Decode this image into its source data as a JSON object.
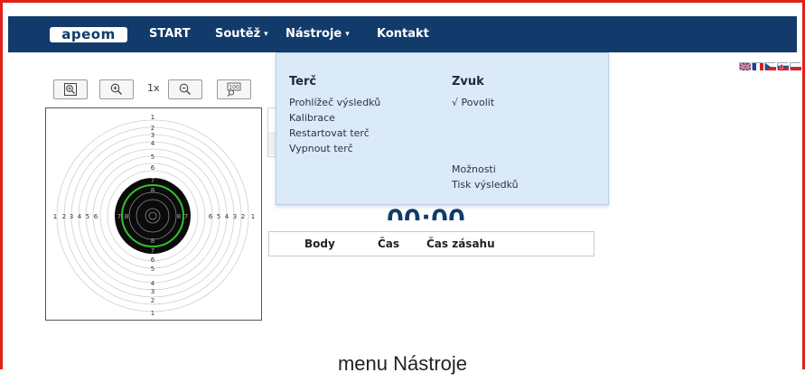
{
  "navbar": {
    "logo_text": "apeom",
    "items": [
      {
        "label": "START",
        "has_caret": false
      },
      {
        "label": "Soutěž",
        "has_caret": true,
        "caret": "▾"
      },
      {
        "label": "Nástroje",
        "has_caret": true,
        "caret": "▾",
        "active": true
      },
      {
        "label": "Kontakt",
        "has_caret": false
      }
    ],
    "background": "#123b6b"
  },
  "languages": [
    "English",
    "Français",
    "Čeština",
    "Slovenčina",
    "Polski"
  ],
  "toolbar": {
    "zoom_fit_icon": "zoom-fit-icon",
    "zoom_in_icon": "zoom-in-icon",
    "zoom_level": "1x",
    "zoom_out_icon": "zoom-out-icon",
    "zoom_100_icon": "zoom-100-icon",
    "zoom_100_text": "100"
  },
  "target": {
    "ring_numbers_vertical_top": [
      "1",
      "2",
      "3",
      "4",
      "5",
      "6",
      "7",
      "8"
    ],
    "ring_numbers_vertical_bottom": [
      "8",
      "7",
      "6",
      "5",
      "4",
      "3",
      "2",
      "1"
    ],
    "ring_numbers_left": [
      "1",
      "2",
      "3",
      "4",
      "5",
      "6",
      "7",
      "8"
    ],
    "ring_numbers_right": [
      "8",
      "7",
      "6",
      "5",
      "4",
      "3",
      "2",
      "1"
    ],
    "highlight_color": "#34c22e"
  },
  "timer": "00:00",
  "results_table": {
    "columns": [
      "Body",
      "Čas",
      "Čas zásahu"
    ]
  },
  "dropdown": {
    "col1_title": "Terč",
    "col1_items": [
      "Prohlížeč výsledků",
      "Kalibrace",
      "Restartovat terč",
      "Vypnout terč"
    ],
    "col2_title": "Zvuk",
    "col2_items": [
      "√ Povolit"
    ],
    "col2_extra": [
      "Možnosti",
      "Tisk výsledků"
    ],
    "background": "#daeaf9"
  },
  "caption": "menu Nástroje",
  "colors": {
    "frame_border": "#e0201b",
    "accent": "#123b6b"
  }
}
